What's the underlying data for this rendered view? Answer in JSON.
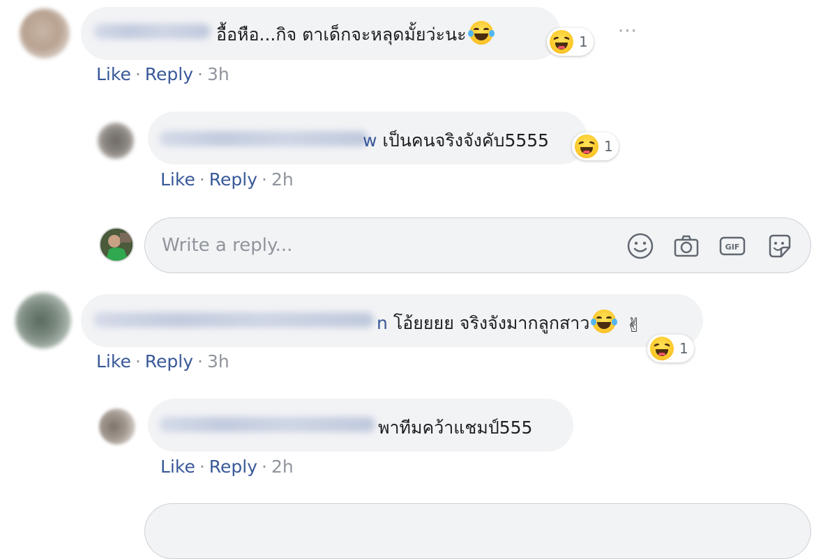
{
  "comments": [
    {
      "text": "อื้อหือ...กิจ ตาเด็กจะหลุดมั้ยว่ะนะ",
      "reaction_count": "1",
      "actions": {
        "like": "Like",
        "reply": "Reply",
        "time": "3h"
      },
      "replies": [
        {
          "name_tail": "w",
          "text": "เป็นคนจริงจังคับ5555",
          "reaction_count": "1",
          "actions": {
            "like": "Like",
            "reply": "Reply",
            "time": "2h"
          }
        }
      ]
    },
    {
      "name_tail": "n",
      "text": "โอ้ยยยย จริงจังมากลูกสาว",
      "reaction_count": "1",
      "actions": {
        "like": "Like",
        "reply": "Reply",
        "time": "3h"
      },
      "replies": [
        {
          "text": "พาทีมคว้าแชมป์555",
          "actions": {
            "like": "Like",
            "reply": "Reply",
            "time": "2h"
          }
        }
      ]
    }
  ],
  "reply_input": {
    "placeholder": "Write a reply..."
  },
  "more_label": "···",
  "separator": "·",
  "icons": {
    "reaction": "haha-reaction-icon",
    "emoji": "tears-of-joy-emoji",
    "peace": "victory-hand-emoji",
    "input_icons": [
      "smiley-icon",
      "camera-icon",
      "gif-icon",
      "sticker-icon"
    ]
  },
  "colors": {
    "link": "#385898",
    "muted": "#90949c",
    "bubble": "#f2f3f5"
  }
}
